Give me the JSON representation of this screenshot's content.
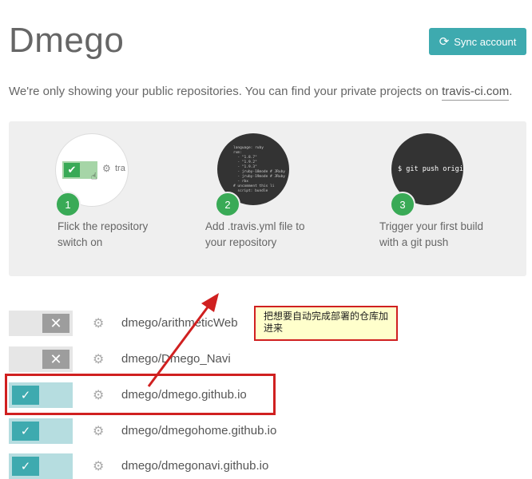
{
  "header": {
    "title": "Dmego",
    "sync_label": "Sync account",
    "sync_icon": "refresh-icon"
  },
  "notice": {
    "text": "We're only showing your public repositories. You can find your private projects on ",
    "link": "travis-ci.com",
    "suffix": "."
  },
  "steps": [
    {
      "number": "1",
      "caption": "Flick the repository switch on",
      "preview_text": "tra"
    },
    {
      "number": "2",
      "caption": "Add .travis.yml file to your repository",
      "code": "language: ruby\nrvm:\n  - \"1.8.7\"\n  - \"1.9.2\"\n  - \"1.9.3\"\n  - jruby-18mode # JRuby\n  - jruby-19mode # JRuby\n  - rbx\n# uncomment this li\n  script: bundle"
    },
    {
      "number": "3",
      "caption": "Trigger your first build with a git push",
      "command": "$ git push origin"
    }
  ],
  "repositories": [
    {
      "name": "dmego/arithmeticWeb",
      "enabled": false
    },
    {
      "name": "dmego/Dmego_Navi",
      "enabled": false
    },
    {
      "name": "dmego/dmego.github.io",
      "enabled": true
    },
    {
      "name": "dmego/dmegohome.github.io",
      "enabled": true
    },
    {
      "name": "dmego/dmegonavi.github.io",
      "enabled": true
    }
  ],
  "annotation": {
    "callout_text": "把想要自动完成部署的仓库加进来"
  },
  "colors": {
    "accent": "#3eaaaf",
    "success": "#39aa56",
    "annotation_red": "#d02020",
    "callout_bg": "#ffffcc"
  }
}
